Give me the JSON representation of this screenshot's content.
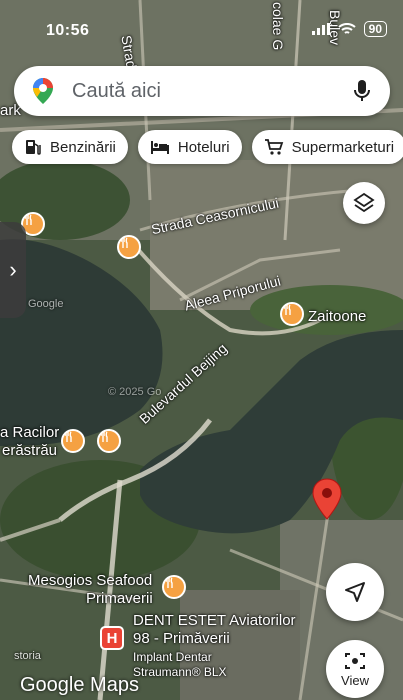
{
  "status_bar": {
    "time": "10:56",
    "battery": "90"
  },
  "search": {
    "placeholder": "Caută aici"
  },
  "chips": [
    {
      "label": "Benzinării",
      "icon": "gas-station-icon"
    },
    {
      "label": "Hoteluri",
      "icon": "bed-icon"
    },
    {
      "label": "Supermarketuri",
      "icon": "cart-icon"
    }
  ],
  "map_labels": {
    "street_top": "Strada Ceasornicului",
    "aleea": "Aleea Priporului",
    "zaitoone": "Zaitoone",
    "bulevard": "Bulevardul Beijing",
    "racilor": "a Racilor",
    "herastrau": "erăstrău",
    "mesogios_1": "Mesogios Seafood",
    "mesogios_2": "Primaverii",
    "dent_1": "DENT ESTET Aviatorilor",
    "dent_2": "98 - Primăverii",
    "dent_3": "Implant Dentar",
    "dent_4": "Straumann® BLX",
    "corner_label": "ark",
    "road_vertical": "colae G",
    "road_vertical_2": "Strada",
    "road_partial": "Bulev",
    "watermark_left": "Google",
    "copyright": "© 2025 Go",
    "storia": "storia"
  },
  "buttons": {
    "view": "View"
  },
  "footer": {
    "google_maps": "Google Maps"
  },
  "colors": {
    "accent": "#1a73e8",
    "pin_orange": "#f5a142",
    "pin_red": "#ea4335",
    "water": "#2e3b36"
  }
}
